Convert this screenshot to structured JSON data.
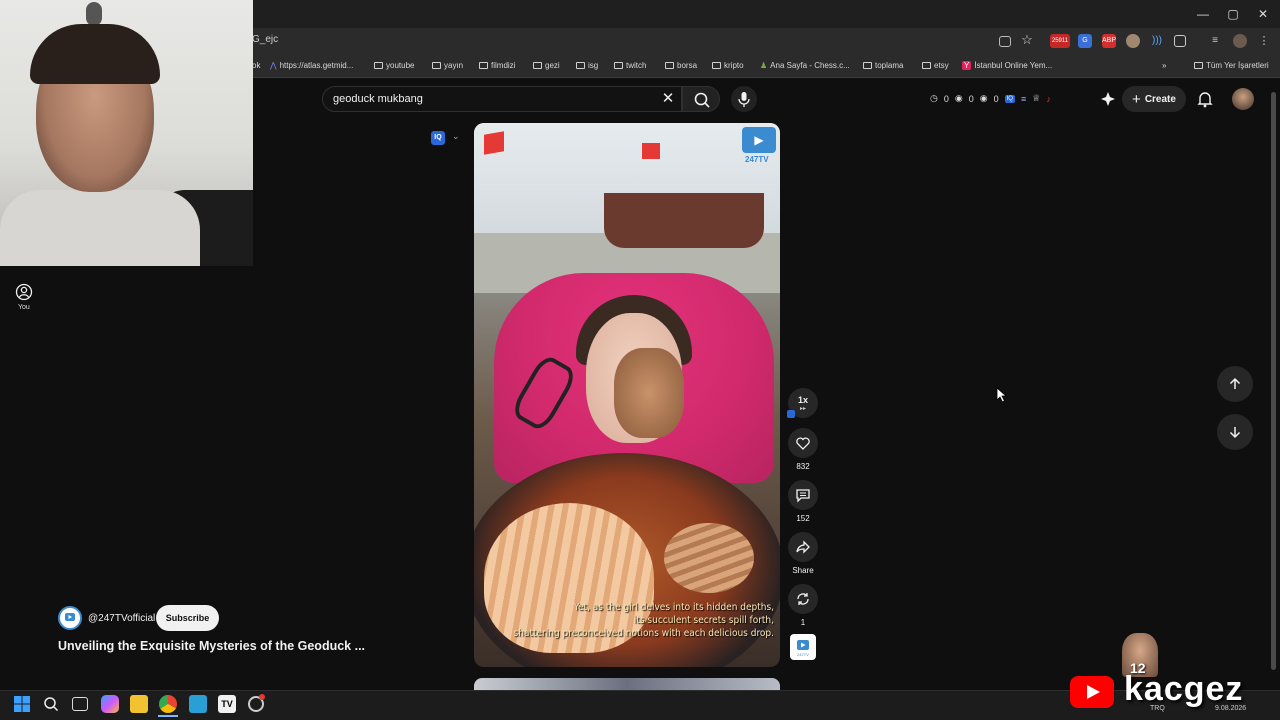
{
  "browser": {
    "url_fragment": "G_ejc",
    "window_controls": {
      "minimize": "—",
      "maximize": "▢",
      "close": "✕"
    },
    "ext_badge": "25911",
    "bookmarks": [
      {
        "label": "ok",
        "type": "partial"
      },
      {
        "label": "https://atlas.getmid...",
        "type": "link"
      },
      {
        "label": "youtube",
        "type": "folder"
      },
      {
        "label": "yayın",
        "type": "folder"
      },
      {
        "label": "filmdizi",
        "type": "folder"
      },
      {
        "label": "gezi",
        "type": "folder"
      },
      {
        "label": "isg",
        "type": "folder"
      },
      {
        "label": "twitch",
        "type": "folder"
      },
      {
        "label": "borsa",
        "type": "folder"
      },
      {
        "label": "kripto",
        "type": "folder"
      },
      {
        "label": "Ana Sayfa - Chess.c...",
        "type": "link"
      },
      {
        "label": "toplama",
        "type": "folder"
      },
      {
        "label": "etsy",
        "type": "folder"
      },
      {
        "label": "İstanbul Online Yem...",
        "type": "link"
      },
      {
        "label": "»",
        "type": "overflow"
      },
      {
        "label": "Tüm Yer İşaretleri",
        "type": "folder"
      }
    ]
  },
  "header": {
    "search_query": "geoduck mukbang",
    "counters": [
      "0",
      "0",
      "0"
    ],
    "create_label": "Create",
    "accent": "#ff0000"
  },
  "sidebar": {
    "you_label": "You"
  },
  "short": {
    "channel_logo_text": "247TV",
    "subtitle_lines": [
      "Yet, as the girl delves into its hidden depths,",
      "its succulent secrets spill forth,",
      "shattering preconceived notions with each delicious drop."
    ],
    "iq_badge": "IQ",
    "channel_handle": "@247TVofficial",
    "subscribe_label": "Subscribe",
    "title": "Unveiling the Exquisite Mysteries of the Geoduck ..."
  },
  "actions": {
    "speed": "1x",
    "likes": "832",
    "comments": "152",
    "share_label": "Share",
    "remix_count": "1"
  },
  "taskbar": {
    "tray_lang": "TRQ",
    "date": "9.08.2026"
  },
  "watermark": {
    "text": "kacgez",
    "number": "12"
  }
}
